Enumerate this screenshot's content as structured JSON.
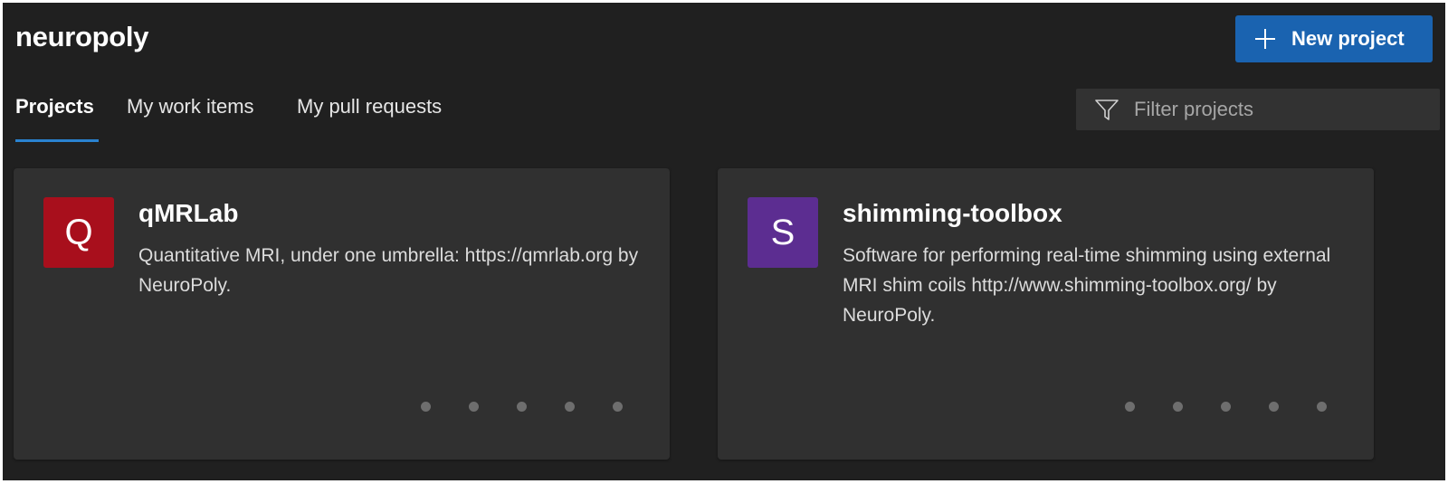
{
  "header": {
    "org_name": "neuropoly",
    "new_project_label": "New project",
    "new_project_icon": "plus-icon"
  },
  "tabs": [
    {
      "label": "Projects",
      "active": true
    },
    {
      "label": "My work items",
      "active": false
    },
    {
      "label": "My pull requests",
      "active": false
    }
  ],
  "filter": {
    "placeholder": "Filter projects",
    "value": "",
    "icon": "funnel-icon"
  },
  "projects": [
    {
      "initial": "Q",
      "name": "qMRLab",
      "description": "Quantitative MRI, under one umbrella: https://qmrlab.org by NeuroPoly.",
      "color": "#a80f1c"
    },
    {
      "initial": "S",
      "name": "shimming-toolbox",
      "description": "Software for performing real-time shimming using external MRI shim coils http://www.shimming-toolbox.org/ by NeuroPoly.",
      "color": "#5c2d91"
    }
  ],
  "colors": {
    "background": "#202020",
    "card": "#303030",
    "accent": "#1a63b0",
    "tab_underline": "#2a82d0"
  }
}
